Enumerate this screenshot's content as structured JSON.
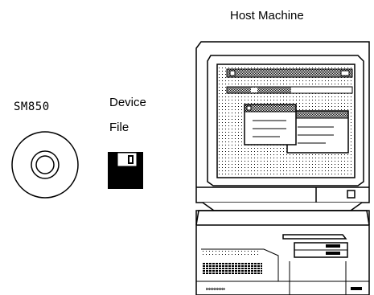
{
  "labels": {
    "host_machine": "Host Machine",
    "sm850": "SM850",
    "device_file_line1": "Device",
    "device_file_line2": "File"
  },
  "icons": [
    "cd-disc-icon",
    "floppy-disk-icon",
    "desktop-computer-icon"
  ],
  "colors": {
    "ink": "#000000",
    "paper": "#ffffff"
  }
}
